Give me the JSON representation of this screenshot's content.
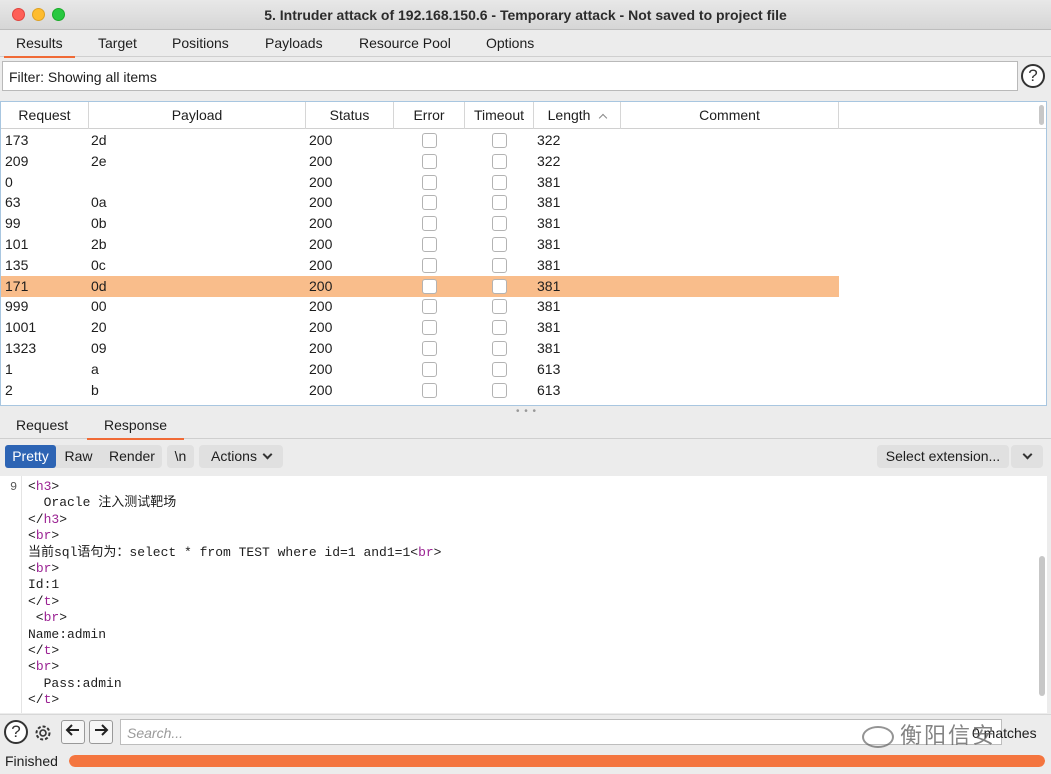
{
  "window": {
    "title": "5. Intruder attack of 192.168.150.6 - Temporary attack - Not saved to project file"
  },
  "tabs": [
    "Results",
    "Target",
    "Positions",
    "Payloads",
    "Resource Pool",
    "Options"
  ],
  "filter": {
    "text": "Filter: Showing all items",
    "help": "?"
  },
  "table": {
    "headers": [
      "Request",
      "Payload",
      "Status",
      "Error",
      "Timeout",
      "Length",
      "Comment"
    ],
    "sort_indicator": "^",
    "selected_row": 7,
    "rows": [
      {
        "request": "173",
        "payload": "2d",
        "status": "200",
        "length": "322"
      },
      {
        "request": "209",
        "payload": "2e",
        "status": "200",
        "length": "322"
      },
      {
        "request": "0",
        "payload": "",
        "status": "200",
        "length": "381"
      },
      {
        "request": "63",
        "payload": "0a",
        "status": "200",
        "length": "381"
      },
      {
        "request": "99",
        "payload": "0b",
        "status": "200",
        "length": "381"
      },
      {
        "request": "101",
        "payload": "2b",
        "status": "200",
        "length": "381"
      },
      {
        "request": "135",
        "payload": "0c",
        "status": "200",
        "length": "381"
      },
      {
        "request": "171",
        "payload": "0d",
        "status": "200",
        "length": "381"
      },
      {
        "request": "999",
        "payload": "00",
        "status": "200",
        "length": "381"
      },
      {
        "request": "1001",
        "payload": "20",
        "status": "200",
        "length": "381"
      },
      {
        "request": "1323",
        "payload": "09",
        "status": "200",
        "length": "381"
      },
      {
        "request": "1",
        "payload": "a",
        "status": "200",
        "length": "613"
      },
      {
        "request": "2",
        "payload": "b",
        "status": "200",
        "length": "613"
      }
    ]
  },
  "detail_tabs": [
    "Request",
    "Response"
  ],
  "toolbar": {
    "pretty": "Pretty",
    "raw": "Raw",
    "render": "Render",
    "newline": "\\n",
    "actions": "Actions",
    "select_extension": "Select extension..."
  },
  "editor": {
    "first_line_number": "9",
    "lines": [
      [
        {
          "t": "<",
          "tag": false
        },
        {
          "t": "h3",
          "tag": true
        },
        {
          "t": ">",
          "tag": false
        }
      ],
      [
        {
          "t": "  Oracle 注入测试靶场",
          "tag": false
        }
      ],
      [
        {
          "t": "</",
          "tag": false
        },
        {
          "t": "h3",
          "tag": true
        },
        {
          "t": ">",
          "tag": false
        }
      ],
      [
        {
          "t": "<",
          "tag": false
        },
        {
          "t": "br",
          "tag": true
        },
        {
          "t": ">",
          "tag": false
        }
      ],
      [
        {
          "t": "当前sql语句为：select * from TEST where id=1 and1=1<",
          "tag": false
        },
        {
          "t": "br",
          "tag": true
        },
        {
          "t": ">",
          "tag": false
        }
      ],
      [
        {
          "t": "<",
          "tag": false
        },
        {
          "t": "br",
          "tag": true
        },
        {
          "t": ">",
          "tag": false
        }
      ],
      [
        {
          "t": "Id:1",
          "tag": false
        }
      ],
      [
        {
          "t": "</",
          "tag": false
        },
        {
          "t": "t",
          "tag": true
        },
        {
          "t": ">",
          "tag": false
        }
      ],
      [
        {
          "t": " <",
          "tag": false
        },
        {
          "t": "br",
          "tag": true
        },
        {
          "t": ">",
          "tag": false
        }
      ],
      [
        {
          "t": "Name:admin",
          "tag": false
        }
      ],
      [
        {
          "t": "</",
          "tag": false
        },
        {
          "t": "t",
          "tag": true
        },
        {
          "t": ">",
          "tag": false
        }
      ],
      [
        {
          "t": "<",
          "tag": false
        },
        {
          "t": "br",
          "tag": true
        },
        {
          "t": ">",
          "tag": false
        }
      ],
      [
        {
          "t": "  Pass:admin",
          "tag": false
        }
      ],
      [
        {
          "t": "</",
          "tag": false
        },
        {
          "t": "t",
          "tag": true
        },
        {
          "t": ">",
          "tag": false
        }
      ]
    ]
  },
  "search": {
    "placeholder": "Search...",
    "matches": "0 matches"
  },
  "watermark": "衡阳信安",
  "status": {
    "text": "Finished",
    "progress_fraction": 1.0,
    "progress_color": "#f4753f"
  },
  "colors": {
    "accent": "#f06a36",
    "selected_row": "#f9bd8b",
    "active_button": "#2d64b4"
  }
}
